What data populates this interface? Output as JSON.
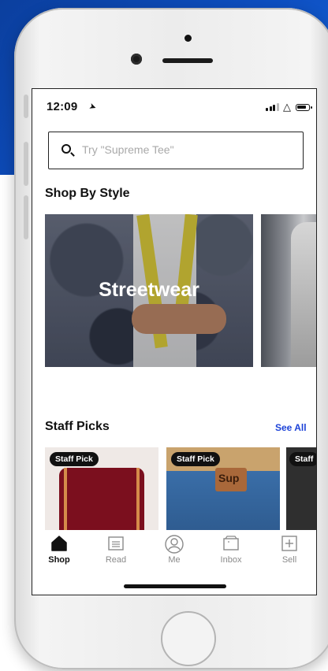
{
  "status": {
    "time": "12:09",
    "location_icon": "location-arrow-icon"
  },
  "search": {
    "placeholder": "Try \"Supreme Tee\""
  },
  "shop_by_style": {
    "title": "Shop By Style",
    "cards": [
      {
        "label": "Streetwear"
      }
    ]
  },
  "staff_picks": {
    "title": "Staff Picks",
    "see_all": "See All",
    "items": [
      {
        "badge": "Staff Pick"
      },
      {
        "badge": "Staff Pick"
      },
      {
        "badge": "Staff"
      }
    ]
  },
  "tabs": [
    {
      "label": "Shop",
      "icon": "home-icon",
      "active": true
    },
    {
      "label": "Read",
      "icon": "document-icon",
      "active": false
    },
    {
      "label": "Me",
      "icon": "profile-icon",
      "active": false
    },
    {
      "label": "Inbox",
      "icon": "inbox-icon",
      "active": false
    },
    {
      "label": "Sell",
      "icon": "plus-square-icon",
      "active": false
    }
  ],
  "colors": {
    "accent": "#1d43d8",
    "background_blue": "#0e4fc2"
  }
}
